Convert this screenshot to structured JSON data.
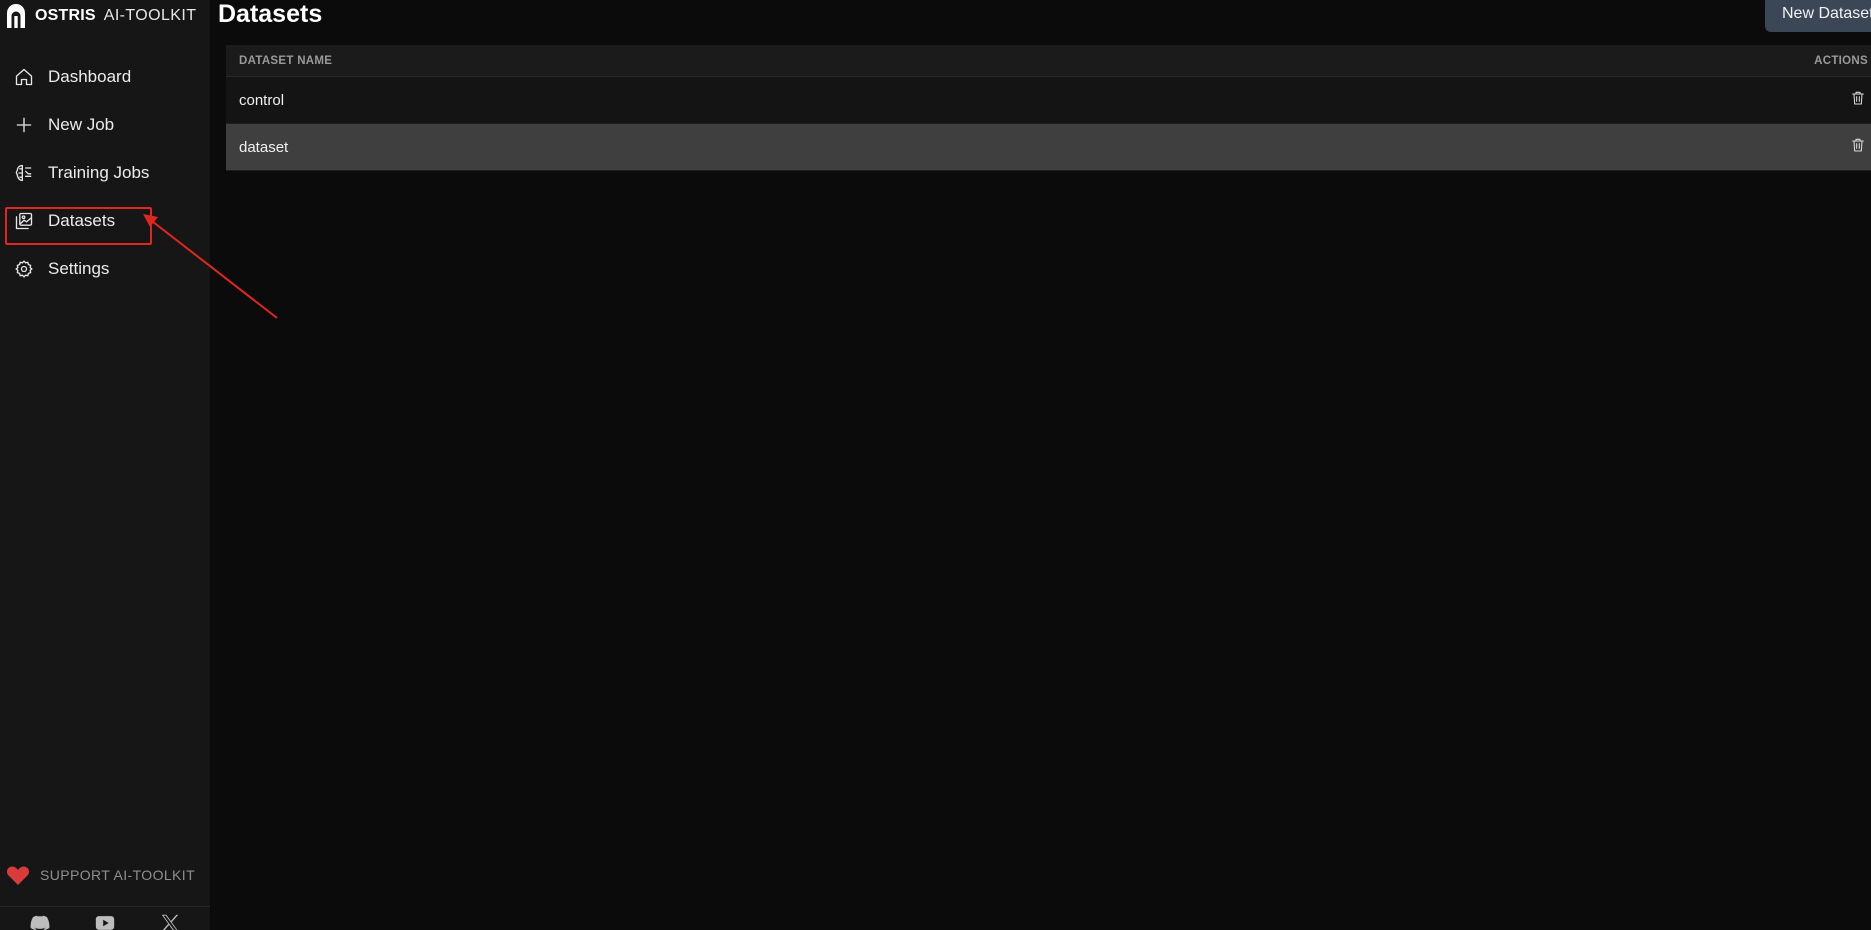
{
  "brand": {
    "name_bold": "OSTRIS",
    "name_light": "AI-TOOLKIT"
  },
  "sidebar": {
    "items": [
      {
        "label": "Dashboard",
        "icon": "home-icon"
      },
      {
        "label": "New Job",
        "icon": "plus-icon"
      },
      {
        "label": "Training Jobs",
        "icon": "brain-icon"
      },
      {
        "label": "Datasets",
        "icon": "images-icon",
        "highlighted": true
      },
      {
        "label": "Settings",
        "icon": "gear-icon"
      }
    ],
    "support_label": "SUPPORT AI-TOOLKIT",
    "social": [
      "discord-icon",
      "youtube-icon",
      "x-icon"
    ]
  },
  "page": {
    "title": "Datasets",
    "new_button_label": "New Dataset"
  },
  "table": {
    "headers": {
      "name": "DATASET NAME",
      "actions": "ACTIONS"
    },
    "rows": [
      {
        "name": "control"
      },
      {
        "name": "dataset"
      }
    ]
  },
  "colors": {
    "accent_button": "#3b4657",
    "annotation": "#e0261f",
    "heart": "#d93a3a",
    "selected_row": "#3f3f3f"
  }
}
